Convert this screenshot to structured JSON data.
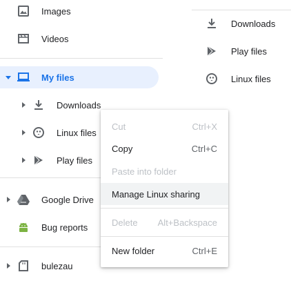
{
  "nav": {
    "images": "Images",
    "videos": "Videos",
    "my_files": "My files",
    "downloads": "Downloads",
    "linux_files": "Linux files",
    "play_files": "Play files",
    "google_drive": "Google Drive",
    "bug_reports": "Bug reports",
    "bulezau": "bulezau"
  },
  "right_pane": {
    "downloads": "Downloads",
    "play_files": "Play files",
    "linux_files": "Linux files"
  },
  "context_menu": {
    "cut": {
      "label": "Cut",
      "shortcut": "Ctrl+X",
      "enabled": false
    },
    "copy": {
      "label": "Copy",
      "shortcut": "Ctrl+C",
      "enabled": true
    },
    "paste": {
      "label": "Paste into folder",
      "enabled": false
    },
    "manage_linux": {
      "label": "Manage Linux sharing",
      "enabled": true,
      "highlighted": true
    },
    "delete": {
      "label": "Delete",
      "shortcut": "Alt+Backspace",
      "enabled": false
    },
    "new_folder": {
      "label": "New folder",
      "shortcut": "Ctrl+E",
      "enabled": true
    }
  },
  "colors": {
    "accent": "#1a73e8",
    "selected_bg": "#e8f0fe",
    "android_green": "#7cb342",
    "disabled_text": "#bdc1c6"
  }
}
